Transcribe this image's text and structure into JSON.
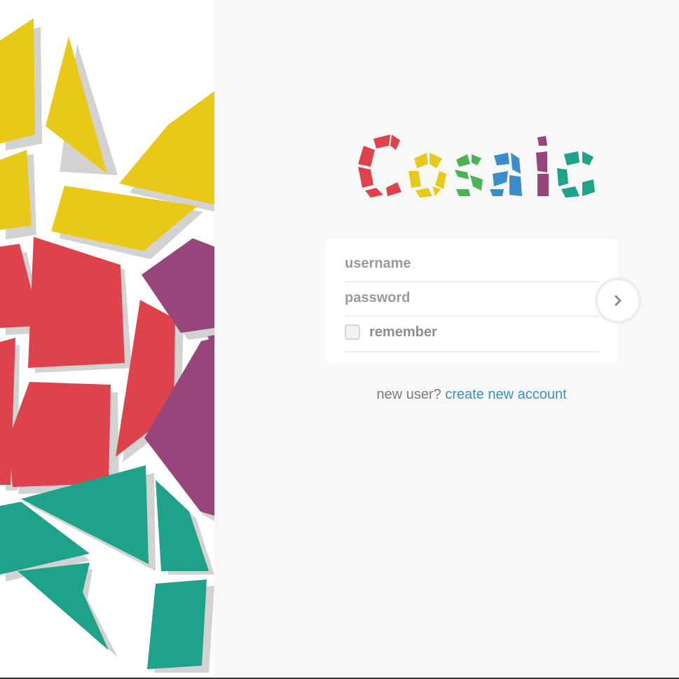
{
  "app": {
    "logo_text": "Cosaic"
  },
  "login_form": {
    "username_placeholder": "username",
    "password_placeholder": "password",
    "remember_label": "remember",
    "remember_checked": false,
    "submit_icon": "chevron-right-icon"
  },
  "signup": {
    "prompt": "new user?",
    "link_label": "create new account"
  },
  "colors": {
    "background": "#f8f8f8",
    "yellow": "#e8c917",
    "red": "#de434c",
    "purple": "#97457a",
    "teal": "#1ea28a",
    "blue": "#3a8dc8",
    "green": "#4cb352",
    "shadow": "#d0d0d0"
  }
}
